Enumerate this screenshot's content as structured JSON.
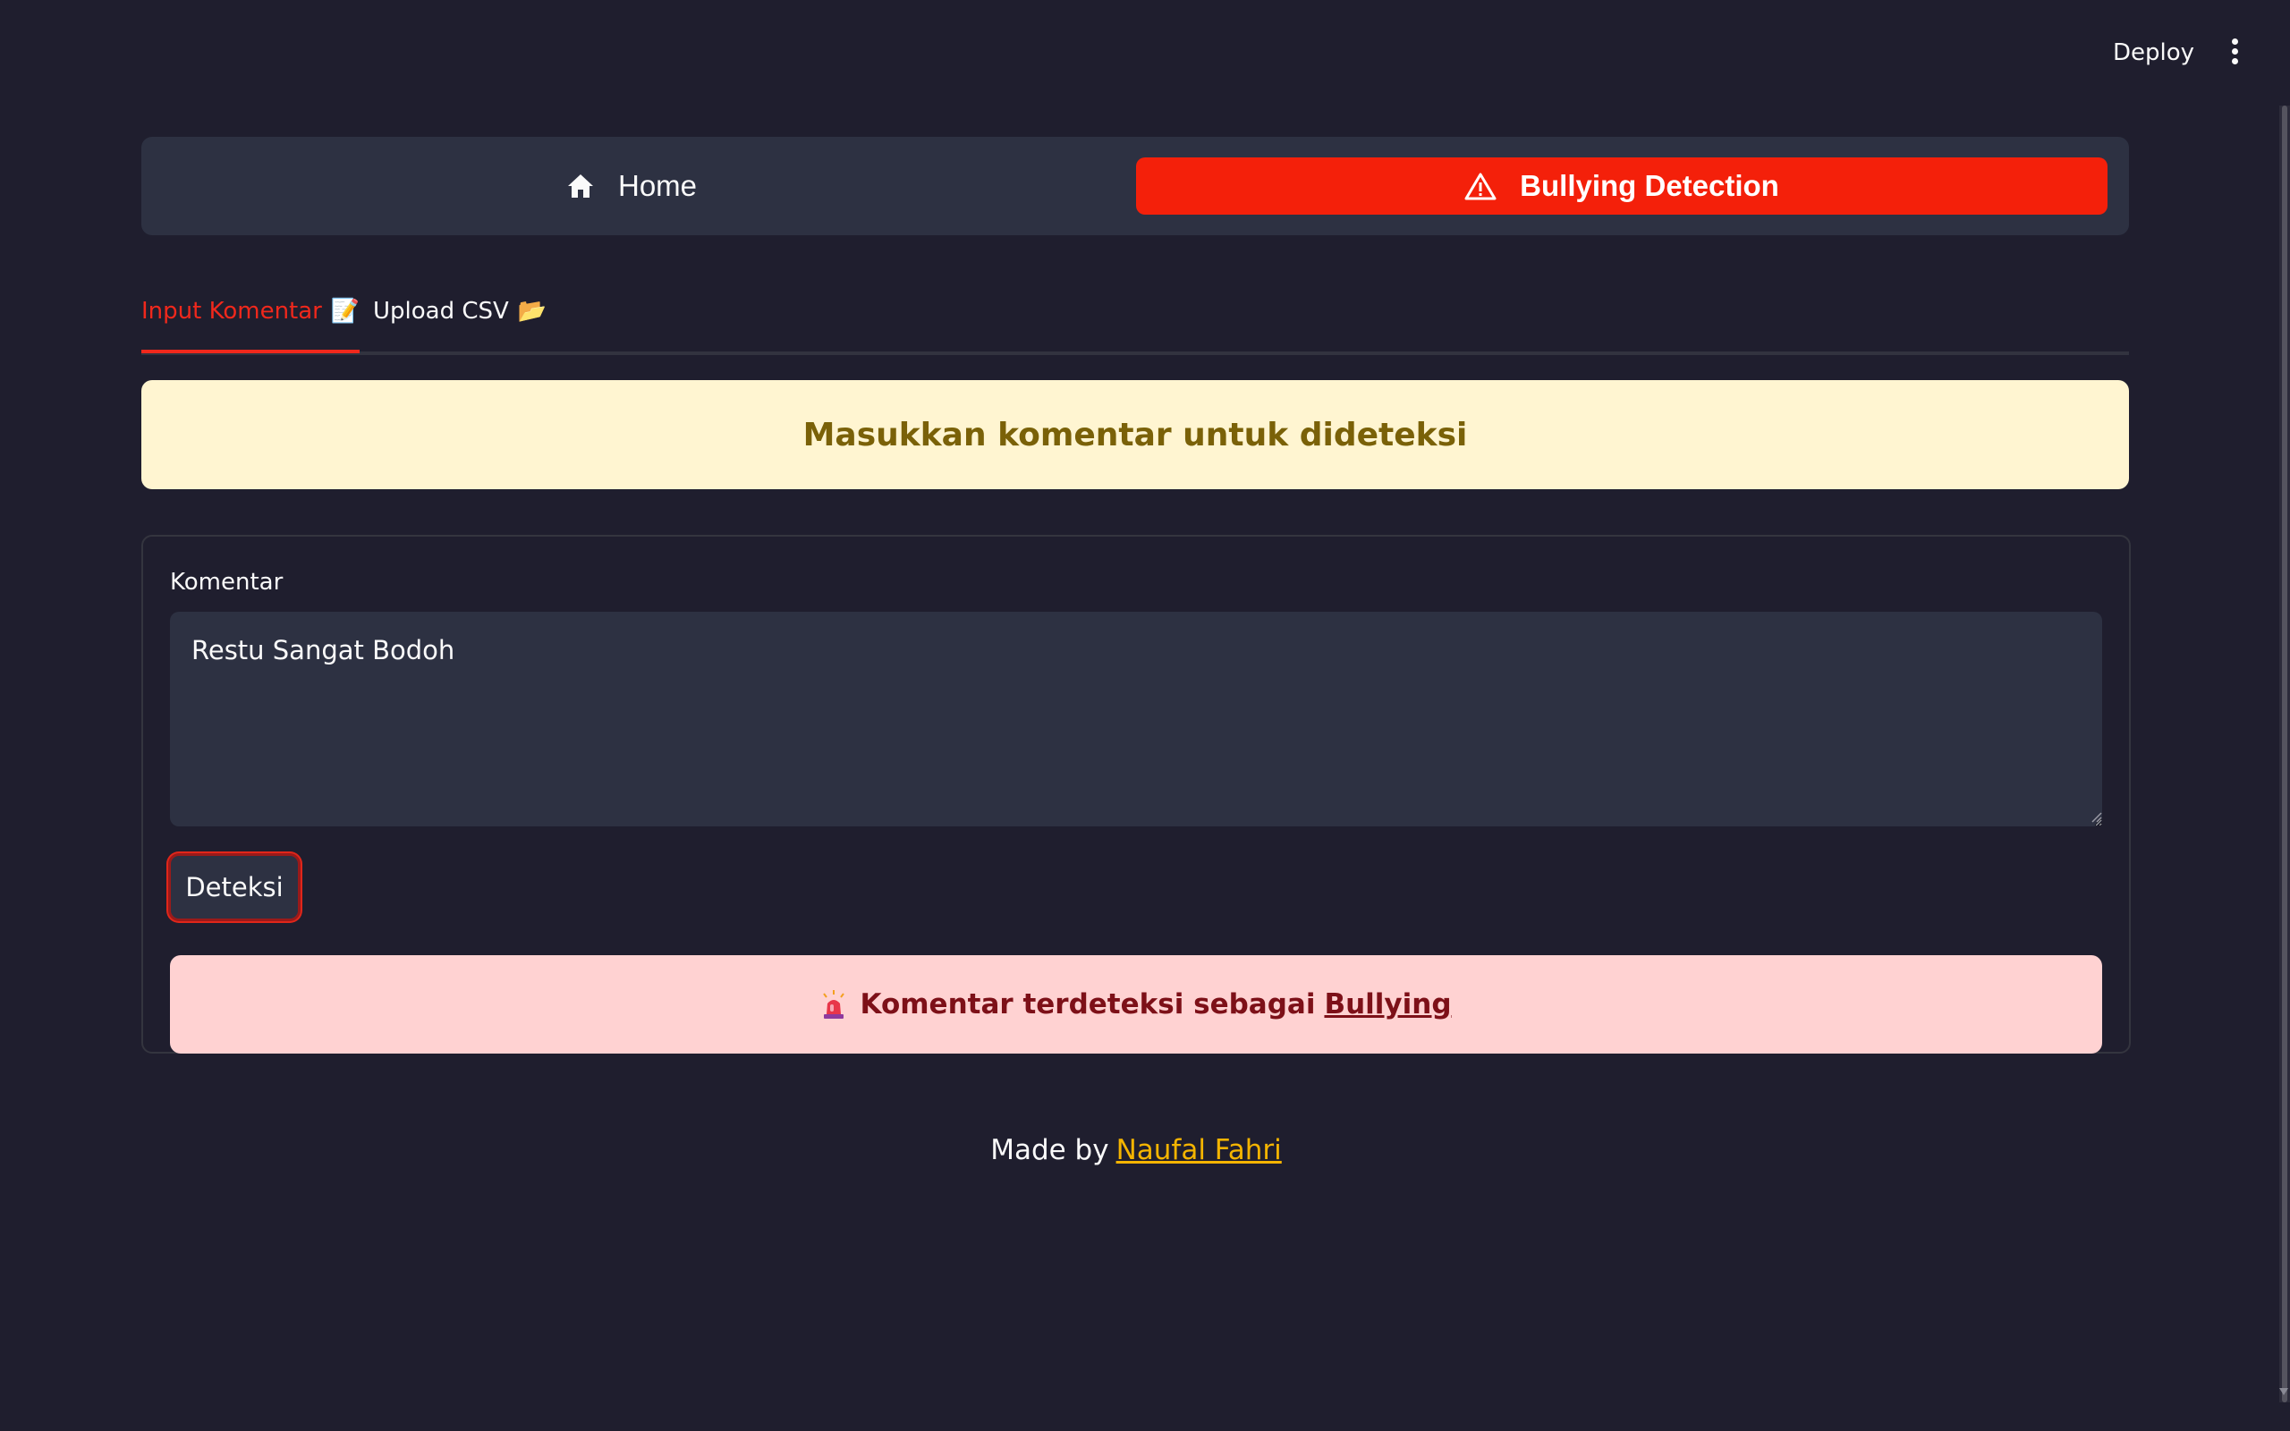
{
  "header": {
    "deploy_label": "Deploy",
    "menu_icon": "kebab-menu-icon"
  },
  "nav": {
    "home_label": "Home",
    "home_icon": "home-icon",
    "bullying_label": "Bullying Detection",
    "bullying_icon": "warning-triangle-icon",
    "active_color": "#f4200a"
  },
  "tabs": [
    {
      "label": "Input Komentar",
      "emoji": "📝",
      "active": true
    },
    {
      "label": "Upload CSV",
      "emoji": "📂",
      "active": false
    }
  ],
  "banner": {
    "text": "Masukkan komentar untuk dideteksi"
  },
  "form": {
    "label": "Komentar",
    "value": "Restu Sangat Bodoh",
    "button_label": "Deteksi"
  },
  "result": {
    "icon": "siren-icon",
    "prefix": "Komentar terdeteksi sebagai",
    "highlight": "Bullying"
  },
  "footer": {
    "prefix": "Made by",
    "author": "Naufal Fahri"
  }
}
